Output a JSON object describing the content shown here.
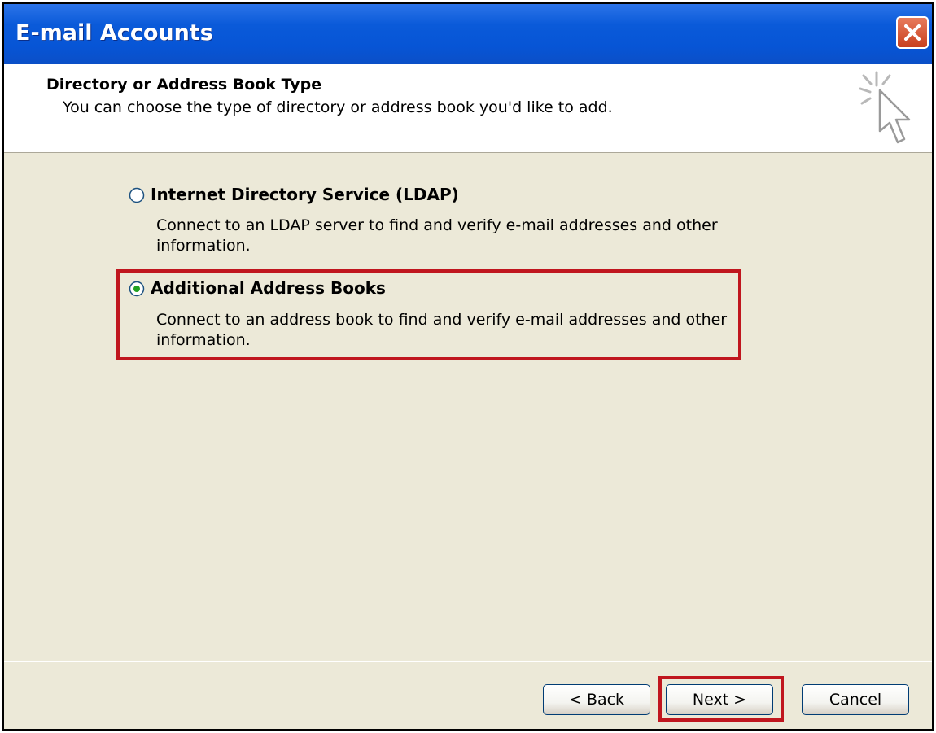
{
  "window": {
    "title": "E-mail Accounts"
  },
  "header": {
    "title": "Directory or Address Book Type",
    "subtitle": "You can choose the type of directory or address book you'd like to add."
  },
  "options": [
    {
      "label": "Internet Directory Service (LDAP)",
      "description": "Connect to an LDAP server to find and verify e-mail addresses and other information.",
      "selected": false
    },
    {
      "label": "Additional Address Books",
      "description": "Connect to an address book to find and verify e-mail addresses and other information.",
      "selected": true
    }
  ],
  "buttons": {
    "back": "< Back",
    "next": "Next >",
    "cancel": "Cancel"
  },
  "colors": {
    "titlebar": "#0755d6",
    "dialog_bg": "#ece9d8",
    "highlight": "#c0161e",
    "close_button": "#d9522e"
  },
  "icons": {
    "close": "close-icon",
    "wizard": "cursor-sparkle-icon"
  }
}
